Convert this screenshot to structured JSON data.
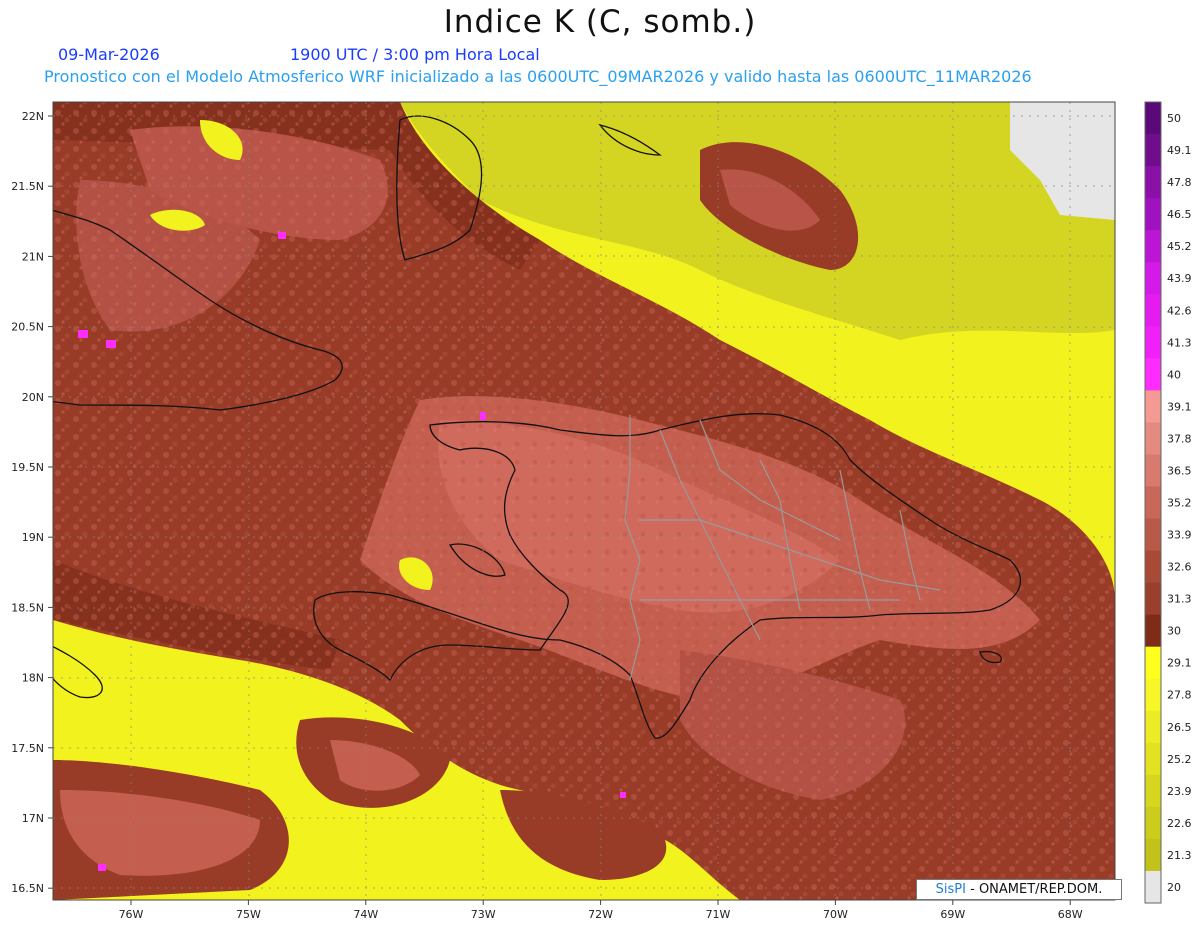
{
  "title": "Indice K (C, somb.)",
  "date": "09-Mar-2026",
  "time": "1900 UTC / 3:00 pm Hora Local",
  "model_line": "Pronostico con el Modelo Atmosferico WRF inicializado a las 0600UTC_09MAR2026 y valido hasta las  0600UTC_11MAR2026",
  "lat_labels": [
    "22N",
    "21.5N",
    "21N",
    "20.5N",
    "20N",
    "19.5N",
    "19N",
    "18.5N",
    "18N",
    "17.5N",
    "17N",
    "16.5N"
  ],
  "lon_labels": [
    "76W",
    "75W",
    "74W",
    "73W",
    "72W",
    "71W",
    "70W",
    "69W",
    "68W"
  ],
  "colorbar": {
    "labels": [
      "50",
      "49.1",
      "47.8",
      "46.5",
      "45.2",
      "43.9",
      "42.6",
      "41.3",
      "40",
      "39.1",
      "37.8",
      "36.5",
      "35.2",
      "33.9",
      "32.6",
      "31.3",
      "30",
      "29.1",
      "27.8",
      "26.5",
      "25.2",
      "23.9",
      "22.6",
      "21.3",
      "20"
    ],
    "colors": [
      "#5a0a78",
      "#6f0d8c",
      "#8a10a8",
      "#a012c0",
      "#bb16d6",
      "#d41ae8",
      "#e41cf0",
      "#f020f8",
      "#ff2cff",
      "#f49a92",
      "#e48a80",
      "#d87a6e",
      "#c96758",
      "#b85a48",
      "#a94a36",
      "#9a3f2c",
      "#7e2c17",
      "#ffff1e",
      "#f6f628",
      "#ecec26",
      "#e2e222",
      "#d6d61e",
      "#cccc1c",
      "#c2c21a",
      "#e6e6e6"
    ]
  },
  "credit": {
    "brand": "SisPI",
    "text": " - ONAMET/REP.DOM."
  }
}
